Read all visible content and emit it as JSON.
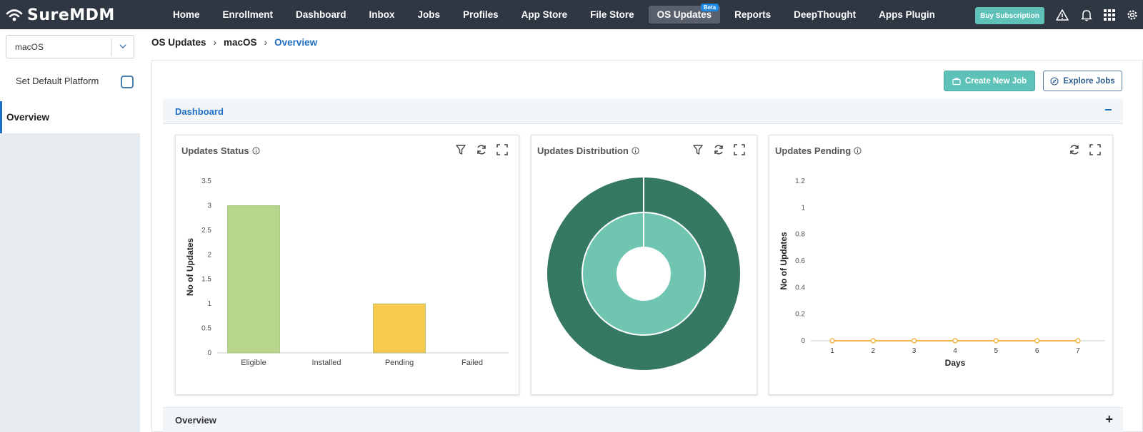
{
  "app": {
    "logo_text": "SureMDM"
  },
  "nav": {
    "items": [
      {
        "label": "Home"
      },
      {
        "label": "Enrollment"
      },
      {
        "label": "Dashboard"
      },
      {
        "label": "Inbox"
      },
      {
        "label": "Jobs"
      },
      {
        "label": "Profiles"
      },
      {
        "label": "App Store"
      },
      {
        "label": "File Store"
      },
      {
        "label": "OS Updates",
        "badge": "Beta",
        "active": true
      },
      {
        "label": "Reports"
      },
      {
        "label": "DeepThought"
      },
      {
        "label": "Apps Plugin"
      }
    ],
    "buy_label": "Buy Subscription"
  },
  "sidebar": {
    "platform_value": "macOS",
    "default_label": "Set Default Platform",
    "default_checked": false,
    "overview_label": "Overview"
  },
  "breadcrumb": {
    "root": "OS Updates",
    "platform": "macOS",
    "current": "Overview"
  },
  "actions": {
    "create_label": "Create New Job",
    "explore_label": "Explore Jobs"
  },
  "dashboard": {
    "section_label": "Dashboard",
    "collapse_glyph": "−",
    "status_card": {
      "title": "Updates Status"
    },
    "distribution_card": {
      "title": "Updates Distribution"
    },
    "pending_card": {
      "title": "Updates Pending"
    }
  },
  "overview_section": {
    "label": "Overview",
    "expand_glyph": "+"
  },
  "colors": {
    "accent": "#5ec2b8",
    "link": "#1e6fc4",
    "topbar": "#2f3742"
  },
  "chart_data": [
    {
      "type": "bar",
      "categories": [
        "Eligible",
        "Installed",
        "Pending",
        "Failed"
      ],
      "values": [
        3,
        0,
        1,
        0
      ],
      "colors": [
        "#b7d58b",
        "#b7d58b",
        "#f7c94d",
        "#f7c94d"
      ],
      "ylabel": "No of Updates",
      "ylim": [
        0,
        3.5
      ],
      "yticks": [
        "0",
        "0.5",
        "1",
        "1.5",
        "2",
        "2.5",
        "3",
        "3.5"
      ],
      "grid": false
    },
    {
      "type": "pie",
      "rings": [
        {
          "name": "outer",
          "values": [
            1
          ],
          "colors": [
            "#357863"
          ]
        },
        {
          "name": "inner",
          "values": [
            1
          ],
          "colors": [
            "#6fc5b0"
          ]
        }
      ]
    },
    {
      "type": "line",
      "x": [
        1,
        2,
        3,
        4,
        5,
        6,
        7
      ],
      "values": [
        0,
        0,
        0,
        0,
        0,
        0,
        0
      ],
      "xlabel": "Days",
      "ylabel": "No of Updates",
      "ylim": [
        0,
        1.2
      ],
      "yticks": [
        "0",
        "0.2",
        "0.4",
        "0.6",
        "0.8",
        "1",
        "1.2"
      ],
      "xticks": [
        "1",
        "2",
        "3",
        "4",
        "5",
        "6",
        "7"
      ],
      "color": "#f0b64a",
      "grid": false
    }
  ]
}
